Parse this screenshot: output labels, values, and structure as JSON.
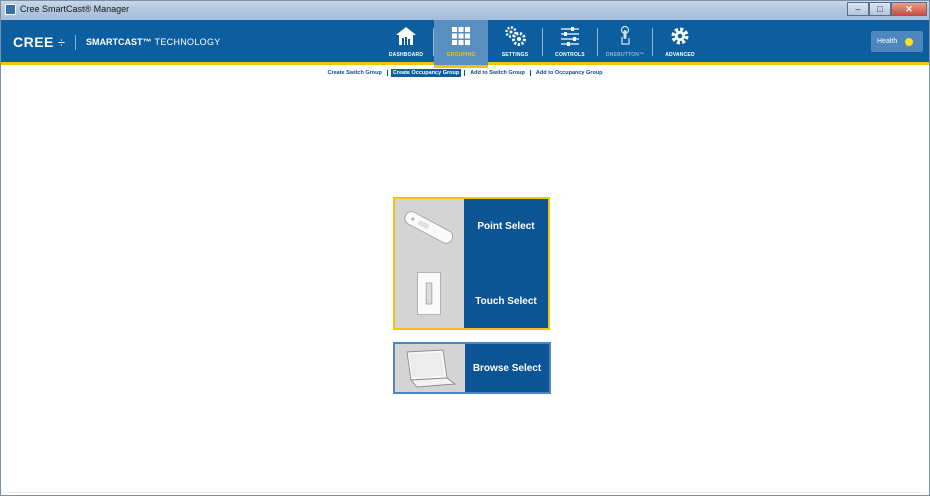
{
  "window": {
    "title": "Cree SmartCast® Manager",
    "controls": [
      "–",
      "□",
      "✕"
    ]
  },
  "brand": {
    "name": "CREE",
    "icon": "cree-logo-icon",
    "product": "SMARTCAST",
    "tm": "™",
    "suffix": "TECHNOLOGY"
  },
  "nav": {
    "tabs": [
      {
        "label": "DASHBOARD",
        "icon": "dashboard-house-icon"
      },
      {
        "label": "GROUPING",
        "icon": "grouping-grid-icon",
        "active": true
      },
      {
        "label": "SETTINGS",
        "icon": "settings-cogs-icon"
      },
      {
        "label": "CONTROLS",
        "icon": "controls-sliders-icon"
      },
      {
        "label": "ONEBUTTON™",
        "icon": "onebutton-icon",
        "disabled": true
      },
      {
        "label": "ADVANCED",
        "icon": "advanced-gear-icon"
      }
    ]
  },
  "health": {
    "label": "Health",
    "status_color": "#f6e51a"
  },
  "subnav": {
    "items": [
      {
        "label": "Create Switch Group"
      },
      {
        "label": "Create Occupancy Group",
        "active": true
      },
      {
        "label": "Add to Switch Group"
      },
      {
        "label": "Add to Occupancy Group"
      }
    ]
  },
  "options": {
    "point_select": "Point Select",
    "touch_select": "Touch Select",
    "browse_select": "Browse Select"
  },
  "colors": {
    "brand_blue": "#0d5e9f",
    "accent_yellow": "#f2c20f",
    "card_blue": "#0c5494"
  }
}
